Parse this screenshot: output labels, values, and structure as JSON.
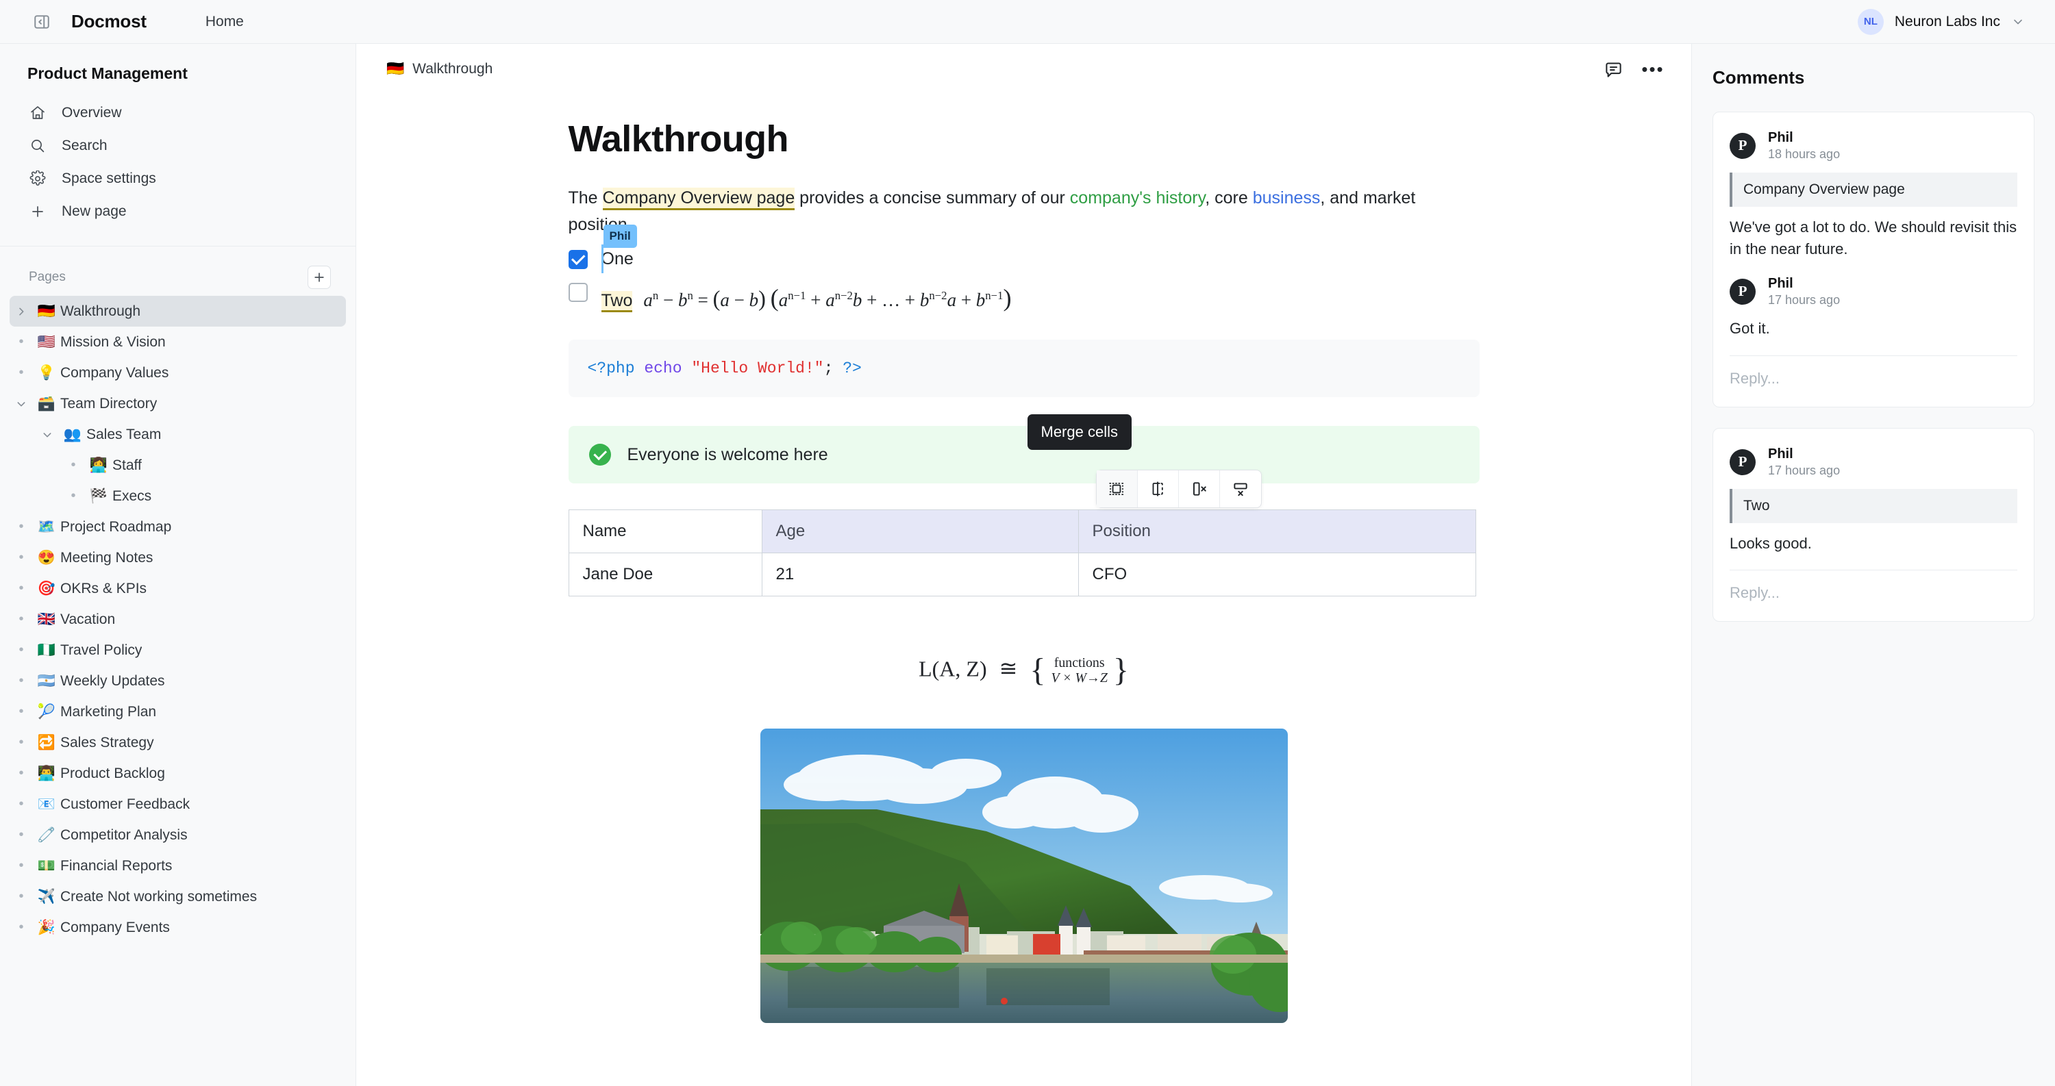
{
  "topbar": {
    "sidebar_toggle_icon": "sidebar-collapse-icon",
    "brand": "Docmost",
    "home_label": "Home",
    "workspace": {
      "initials": "NL",
      "name": "Neuron Labs Inc",
      "chevron_icon": "chevron-down-icon"
    }
  },
  "sidebar": {
    "space_title": "Product Management",
    "nav": [
      {
        "label": "Overview",
        "icon": "home-icon"
      },
      {
        "label": "Search",
        "icon": "search-icon"
      },
      {
        "label": "Space settings",
        "icon": "gear-icon"
      },
      {
        "label": "New page",
        "icon": "plus-icon"
      }
    ],
    "pages_label": "Pages",
    "add_page_icon": "plus-icon",
    "tree": [
      {
        "emoji": "🇩🇪",
        "label": "Walkthrough",
        "indent": 1,
        "twisty": "chevron-right",
        "active": true
      },
      {
        "emoji": "🇺🇸",
        "label": "Mission & Vision",
        "indent": 1,
        "twisty": "bullet",
        "active": false
      },
      {
        "emoji": "💡",
        "label": "Company Values",
        "indent": 1,
        "twisty": "bullet",
        "active": false
      },
      {
        "emoji": "🗃️",
        "label": "Team Directory",
        "indent": 1,
        "twisty": "chevron-down",
        "active": false
      },
      {
        "emoji": "👥",
        "label": "Sales Team",
        "indent": 2,
        "twisty": "chevron-down",
        "active": false
      },
      {
        "emoji": "👩‍💻",
        "label": "Staff",
        "indent": 3,
        "twisty": "bullet",
        "active": false
      },
      {
        "emoji": "🏁",
        "label": "Execs",
        "indent": 3,
        "twisty": "bullet",
        "active": false
      },
      {
        "emoji": "🗺️",
        "label": "Project Roadmap",
        "indent": 1,
        "twisty": "bullet",
        "active": false
      },
      {
        "emoji": "😍",
        "label": "Meeting Notes",
        "indent": 1,
        "twisty": "bullet",
        "active": false
      },
      {
        "emoji": "🎯",
        "label": "OKRs & KPIs",
        "indent": 1,
        "twisty": "bullet",
        "active": false
      },
      {
        "emoji": "🇬🇧",
        "label": "Vacation",
        "indent": 1,
        "twisty": "bullet",
        "active": false
      },
      {
        "emoji": "🇳🇬",
        "label": "Travel Policy",
        "indent": 1,
        "twisty": "bullet",
        "active": false
      },
      {
        "emoji": "🇦🇷",
        "label": "Weekly Updates",
        "indent": 1,
        "twisty": "bullet",
        "active": false
      },
      {
        "emoji": "🎾",
        "label": "Marketing Plan",
        "indent": 1,
        "twisty": "bullet",
        "active": false
      },
      {
        "emoji": "🔁",
        "label": "Sales Strategy",
        "indent": 1,
        "twisty": "bullet",
        "active": false
      },
      {
        "emoji": "👨‍💻",
        "label": "Product Backlog",
        "indent": 1,
        "twisty": "bullet",
        "active": false
      },
      {
        "emoji": "📧",
        "label": "Customer Feedback",
        "indent": 1,
        "twisty": "bullet",
        "active": false
      },
      {
        "emoji": "🧷",
        "label": "Competitor Analysis",
        "indent": 1,
        "twisty": "bullet",
        "active": false
      },
      {
        "emoji": "💵",
        "label": "Financial Reports",
        "indent": 1,
        "twisty": "bullet",
        "active": false
      },
      {
        "emoji": "✈️",
        "label": "Create Not working sometimes",
        "indent": 1,
        "twisty": "bullet",
        "active": false
      },
      {
        "emoji": "🎉",
        "label": "Company Events",
        "indent": 1,
        "twisty": "bullet",
        "active": false
      }
    ]
  },
  "document": {
    "breadcrumb_emoji": "🇩🇪",
    "breadcrumb_label": "Walkthrough",
    "comments_toggle_icon": "comment-icon",
    "more_options_icon": "ellipsis-icon",
    "title": "Walkthrough",
    "paragraph": {
      "lead": "The ",
      "highlighted": "Company Overview page",
      "mid1": " provides a concise summary of our ",
      "green": "company's history",
      "mid2": ", core ",
      "blue": "business",
      "tail": ", and market position."
    },
    "todos": [
      {
        "label": "One",
        "checked": true,
        "cursor_user": "Phil"
      },
      {
        "label": "Two",
        "checked": false,
        "cursor_user": ""
      }
    ],
    "inline_math_latex": "a^n - b^n = (a - b)(a^{n-1} + a^{n-2}b + ... + b^{n-2}a + b^{n-1})",
    "code": {
      "language": "php",
      "open_tag": "<?php",
      "keyword": "echo",
      "string": "\"Hello World!\"",
      "semicolon": ";",
      "close_tag": "?>"
    },
    "callout": {
      "icon": "check-circle-icon",
      "text": "Everyone is welcome here"
    },
    "table_tooltip": "Merge cells",
    "table_toolbar": [
      {
        "icon": "merge-cells-icon",
        "selected": true
      },
      {
        "icon": "split-cell-icon",
        "selected": false
      },
      {
        "icon": "delete-column-icon",
        "selected": false
      },
      {
        "icon": "delete-row-icon",
        "selected": false
      }
    ],
    "table": {
      "headers": [
        "Name",
        "Age",
        "Position"
      ],
      "selected_columns": [
        "Age",
        "Position"
      ],
      "rows": [
        [
          "Jane Doe",
          "21",
          "CFO"
        ]
      ]
    },
    "display_math": {
      "lhs": "L(A, Z)",
      "relation": "≅",
      "rhs_top": "functions",
      "rhs_bottom": "V × W→Z"
    },
    "image_alt": "Heidelberg riverside town with forested hill and old bridge"
  },
  "comments_panel": {
    "title": "Comments",
    "threads": [
      {
        "quote": "Company Overview page",
        "messages": [
          {
            "avatar_letter": "P",
            "author": "Phil",
            "time": "18 hours ago",
            "text": "We've got a lot to do. We should revisit this in the near future."
          },
          {
            "avatar_letter": "P",
            "author": "Phil",
            "time": "17 hours ago",
            "text": "Got it."
          }
        ],
        "reply_placeholder": "Reply..."
      },
      {
        "quote": "Two",
        "messages": [
          {
            "avatar_letter": "P",
            "author": "Phil",
            "time": "17 hours ago",
            "text": "Looks good."
          }
        ],
        "reply_placeholder": "Reply..."
      }
    ]
  },
  "colors": {
    "accent_blue": "#1971e8",
    "cursor_blue": "#74c0fc",
    "highlight_yellow": "#fdf6d8",
    "highlight_underline": "#9b8a12",
    "callout_green_bg": "#ebfbee",
    "callout_green_icon": "#37b24d",
    "link_green": "#2f9e44",
    "link_blue": "#3b6fe0",
    "table_selection": "#e5e7f7",
    "sidebar_bg": "#f8f9fa",
    "tooltip_bg": "#1f2125"
  }
}
